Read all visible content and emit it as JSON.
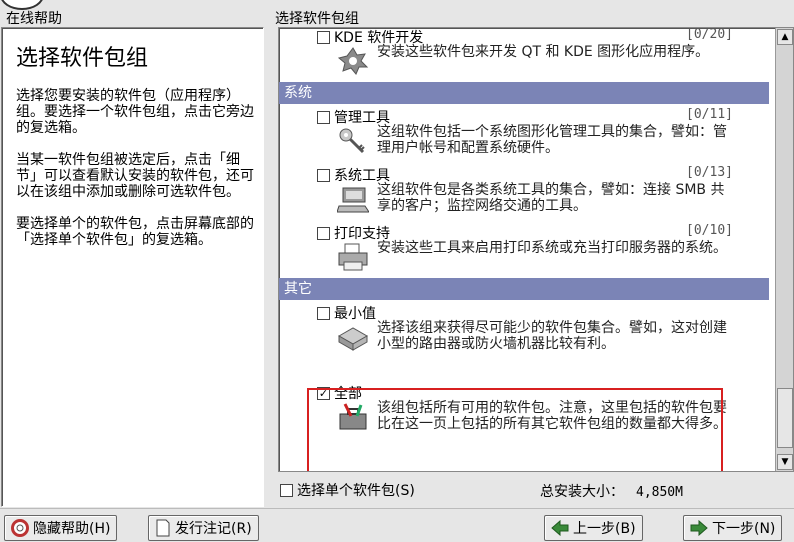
{
  "left_title": "在线帮助",
  "right_title": "选择软件包组",
  "help": {
    "heading": "选择软件包组",
    "paragraphs": [
      "选择您要安装的软件包（应用程序）组。要选择一个软件包组，点击它旁边的复选箱。",
      "当某一软件包组被选定后，点击「细节」可以查看默认安装的软件包，还可以在该组中添加或删除可选软件包。",
      "要选择单个的软件包，点击屏幕底部的「选择单个软件包」的复选箱。"
    ]
  },
  "groups": {
    "kde": {
      "name": "KDE 软件开发",
      "count": "[0/20]",
      "desc": "安装这些软件包来开发 QT 和 KDE 图形化应用程序。",
      "checked": false
    },
    "cat_system": "系统",
    "admin": {
      "name": "管理工具",
      "count": "[0/11]",
      "desc": "这组软件包括一个系统图形化管理工具的集合，譬如：管理用户帐号和配置系统硬件。",
      "checked": false
    },
    "systools": {
      "name": "系统工具",
      "count": "[0/13]",
      "desc": "这组软件包是各类系统工具的集合，譬如：连接 SMB 共享的客户；监控网络交通的工具。",
      "checked": false
    },
    "printing": {
      "name": "打印支持",
      "count": "[0/10]",
      "desc": "安装这些工具来启用打印系统或充当打印服务器的系统。",
      "checked": false
    },
    "cat_other": "其它",
    "minimal": {
      "name": "最小值",
      "desc": "选择该组来获得尽可能少的软件包集合。譬如，这对创建小型的路由器或防火墙机器比较有利。",
      "checked": false
    },
    "everything": {
      "name": "全部",
      "desc": "该组包括所有可用的软件包。注意，这里包括的软件包要比在这一页上包括的所有其它软件包组的数量都大得多。",
      "checked": true
    }
  },
  "select_individual": "选择单个软件包(S)",
  "total_size_label": "总安装大小：",
  "total_size_value": "4,850M",
  "buttons": {
    "hide_help": "隐藏帮助(H)",
    "release_notes": "发行注记(R)",
    "back": "上一步(B)",
    "next": "下一步(N)"
  },
  "colors": {
    "category_bar": "#7b84b6",
    "highlight": "#d82020"
  }
}
